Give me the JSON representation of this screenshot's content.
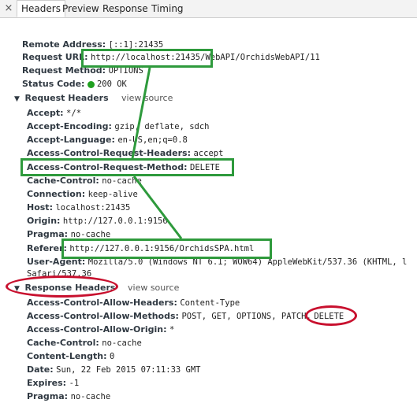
{
  "tabs": {
    "close_glyph": "×",
    "items": [
      "Headers",
      "Preview",
      "Response",
      "Timing"
    ],
    "active": "Headers"
  },
  "general": {
    "remote_address": {
      "key": "Remote Address:",
      "value": "[::1]:21435"
    },
    "request_url": {
      "key": "Request URL:",
      "value": "http://localhost:21435/WebAPI/OrchidsWebAPI/11"
    },
    "request_method": {
      "key": "Request Method:",
      "value": "OPTIONS"
    },
    "status_code": {
      "key": "Status Code:",
      "value": "200 OK",
      "dot_color": "#20a020"
    }
  },
  "request_headers": {
    "title": "Request Headers",
    "view_source": "view source",
    "rows": [
      {
        "key": "Accept:",
        "value": "*/*"
      },
      {
        "key": "Accept-Encoding:",
        "value": "gzip, deflate, sdch"
      },
      {
        "key": "Accept-Language:",
        "value": "en-US,en;q=0.8"
      },
      {
        "key": "Access-Control-Request-Headers:",
        "value": "accept"
      },
      {
        "key": "Access-Control-Request-Method:",
        "value": "DELETE"
      },
      {
        "key": "Cache-Control:",
        "value": "no-cache"
      },
      {
        "key": "Connection:",
        "value": "keep-alive"
      },
      {
        "key": "Host:",
        "value": "localhost:21435"
      },
      {
        "key": "Origin:",
        "value": "http://127.0.0.1:9156"
      },
      {
        "key": "Pragma:",
        "value": "no-cache"
      },
      {
        "key": "Referer:",
        "value": "http://127.0.0.1:9156/OrchidsSPA.html"
      },
      {
        "key": "User-Agent:",
        "value": "Mozilla/5.0 (Windows NT 6.1; WOW64) AppleWebKit/537.36 (KHTML, l"
      },
      {
        "key": "",
        "value": "Safari/537.36"
      }
    ]
  },
  "response_headers": {
    "title": "Response Headers",
    "view_source": "view source",
    "rows": [
      {
        "key": "Access-Control-Allow-Headers:",
        "value": "Content-Type"
      },
      {
        "key": "Access-Control-Allow-Methods:",
        "value": "POST, GET, OPTIONS, PATCH,",
        "value2": "DELETE"
      },
      {
        "key": "Access-Control-Allow-Origin:",
        "value": "*"
      },
      {
        "key": "Cache-Control:",
        "value": "no-cache"
      },
      {
        "key": "Content-Length:",
        "value": "0"
      },
      {
        "key": "Date:",
        "value": "Sun, 22 Feb 2015 07:11:33 GMT"
      },
      {
        "key": "Expires:",
        "value": "-1"
      },
      {
        "key": "Pragma:",
        "value": "no-cache"
      }
    ]
  },
  "annotation_colors": {
    "green": "#2e9a3c",
    "red": "#c8102e"
  }
}
